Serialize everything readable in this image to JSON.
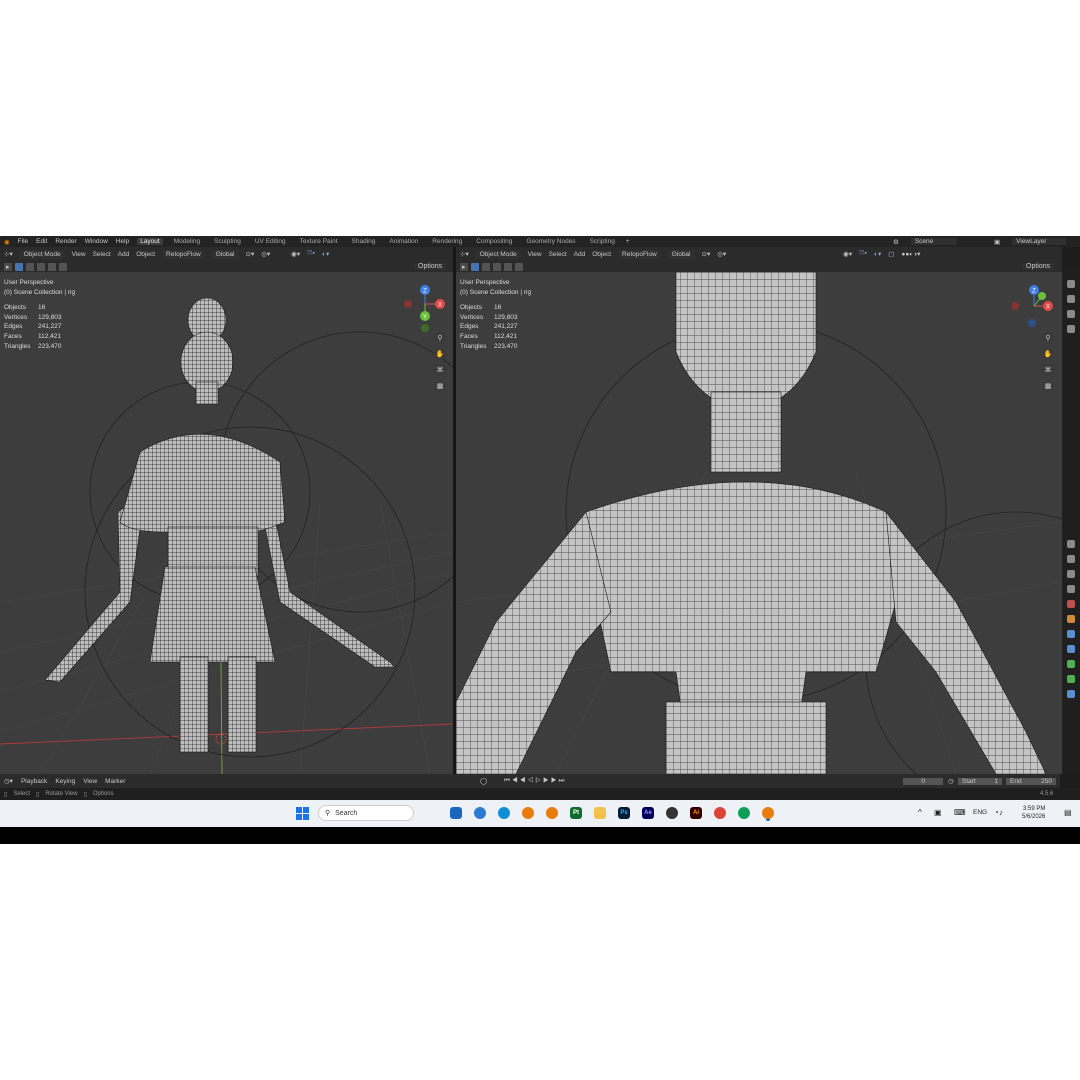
{
  "menu": {
    "items": [
      "File",
      "Edit",
      "Render",
      "Window",
      "Help"
    ],
    "workspaces": [
      "Layout",
      "Modeling",
      "Sculpting",
      "UV Editing",
      "Texture Paint",
      "Shading",
      "Animation",
      "Rendering",
      "Compositing",
      "Geometry Nodes",
      "Scripting"
    ],
    "add_tab": "+",
    "scene": "Scene",
    "view_layer": "ViewLayer"
  },
  "left_viewport": {
    "mode": "Object Mode",
    "menus": [
      "View",
      "Select",
      "Add",
      "Object"
    ],
    "addon": "RetopoFlow",
    "orientation": "Global",
    "options": "Options",
    "perspective": "User Perspective",
    "collection": "(0) Scene Collection | rig",
    "stats": [
      {
        "label": "Objects",
        "value": "16"
      },
      {
        "label": "Vertices",
        "value": "129,803"
      },
      {
        "label": "Edges",
        "value": "241,227"
      },
      {
        "label": "Faces",
        "value": "112,421"
      },
      {
        "label": "Triangles",
        "value": "223,470"
      }
    ]
  },
  "right_viewport": {
    "mode": "Object Mode",
    "menus": [
      "View",
      "Select",
      "Add",
      "Object"
    ],
    "addon": "RetopoFlow",
    "orientation": "Global",
    "options": "Options",
    "perspective": "User Perspective",
    "collection": "(0) Scene Collection | rig",
    "stats": [
      {
        "label": "Objects",
        "value": "16"
      },
      {
        "label": "Vertices",
        "value": "129,803"
      },
      {
        "label": "Edges",
        "value": "241,227"
      },
      {
        "label": "Faces",
        "value": "112,421"
      },
      {
        "label": "Triangles",
        "value": "223,470"
      }
    ]
  },
  "timeline": {
    "menus": [
      "Playback",
      "Keying",
      "View",
      "Marker"
    ],
    "current_frame": "0",
    "start_label": "Start",
    "start": "1",
    "end_label": "End",
    "end": "250"
  },
  "statusbar": {
    "select": "Select",
    "rotate": "Rotate View",
    "options": "Options",
    "version": "4.5.6"
  },
  "taskbar": {
    "search": "Search",
    "lang": "ENG",
    "time": "3:59 PM",
    "date": "5/6/2026",
    "apps": [
      {
        "name": "Pt",
        "color": "#0f6e2e"
      },
      {
        "name": "Ps",
        "color": "#001e36"
      },
      {
        "name": "Ae",
        "color": "#00005b"
      },
      {
        "name": "Ai",
        "color": "#330000"
      }
    ]
  },
  "gizmo": {
    "x": "X",
    "y": "Y",
    "z": "Z"
  },
  "colors": {
    "accent": "#4772b3",
    "x_axis": "#e24a4a",
    "y_axis": "#6bbf3b",
    "z_axis": "#3f7fe2"
  }
}
